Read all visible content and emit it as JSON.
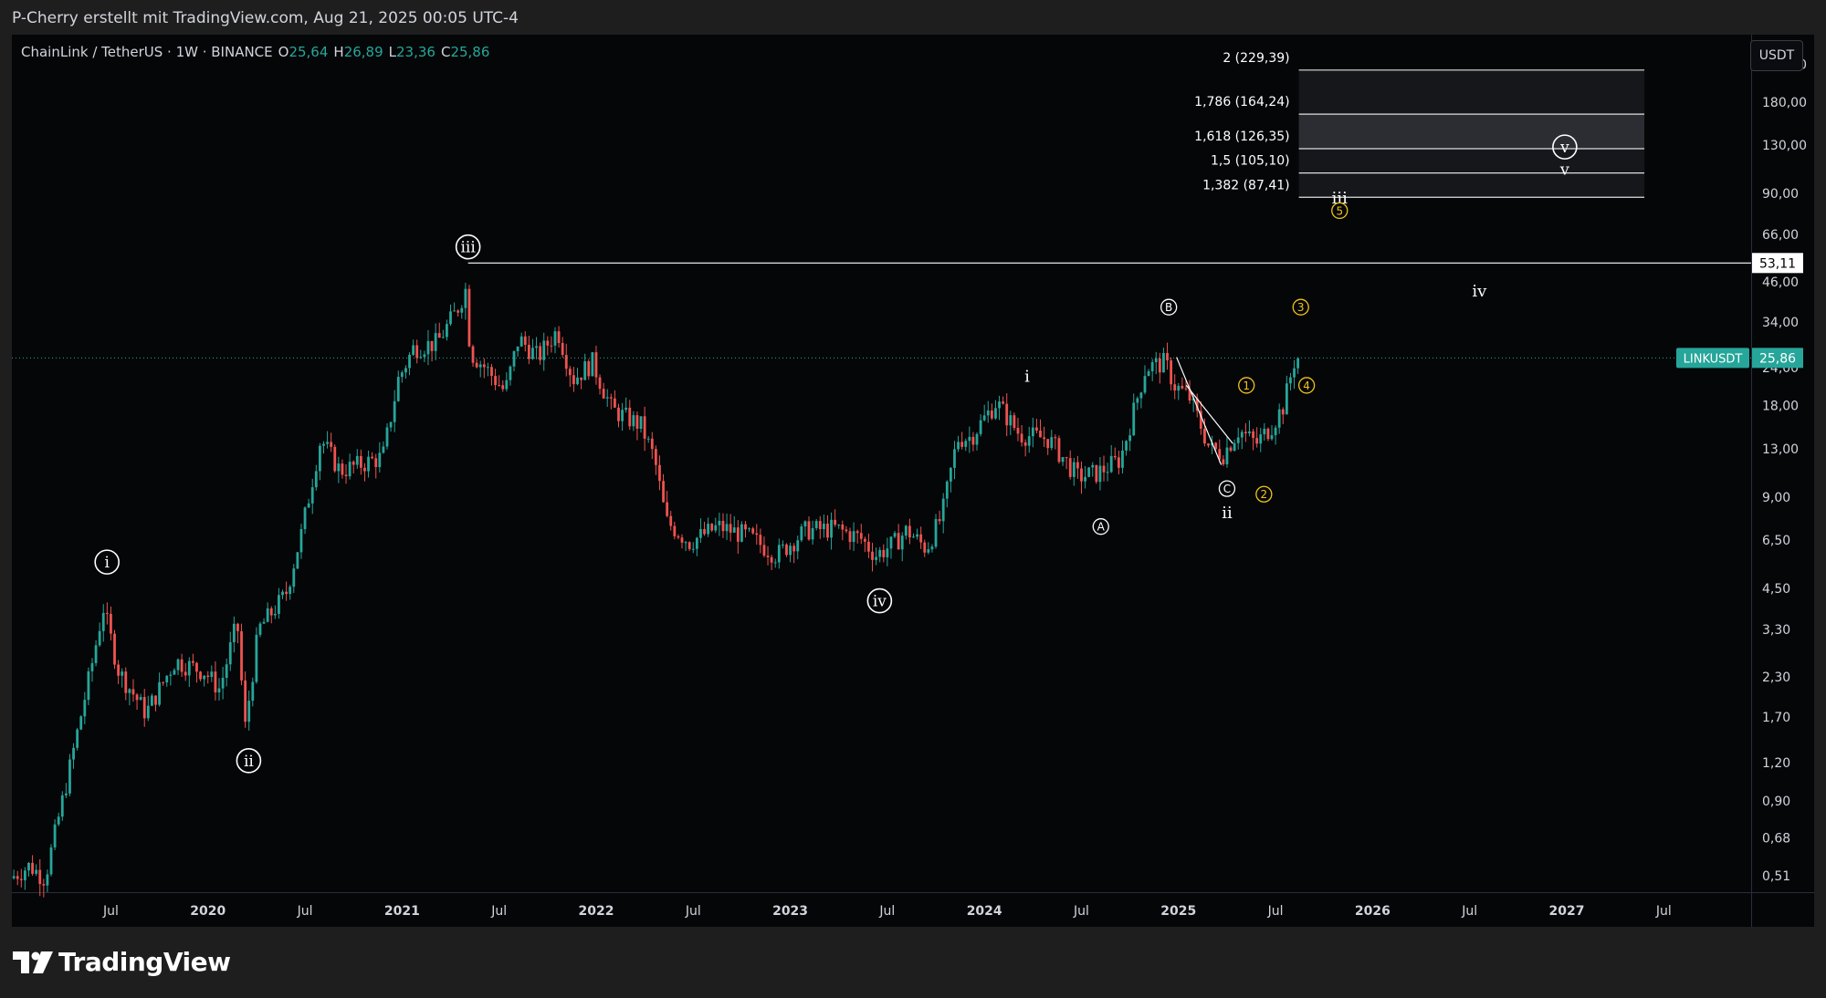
{
  "header": {
    "attribution": "P-Cherry erstellt mit TradingView.com, Aug 21, 2025 00:05 UTC-4"
  },
  "symbol": {
    "name": "ChainLink / TetherUS · 1W · BINANCE",
    "o_label": "O",
    "o_value": "25,64",
    "h_label": "H",
    "h_value": "26,89",
    "l_label": "L",
    "l_value": "23,36",
    "c_label": "C",
    "c_value": "25,86"
  },
  "currency_button": "USDT",
  "footer": {
    "logo_text": "TradingView"
  },
  "colors": {
    "up": "#26a69a",
    "down": "#ef5350",
    "background": "#050608",
    "label_yellow": "#f0c419",
    "price_tag": "#26a69a"
  },
  "chart_data": {
    "type": "candlestick",
    "scale": "log",
    "ylim": [
      0.45,
      300
    ],
    "y_ticks": [
      {
        "value": 240,
        "label": "240,00"
      },
      {
        "value": 180,
        "label": "180,00"
      },
      {
        "value": 130,
        "label": "130,00"
      },
      {
        "value": 90,
        "label": "90,00"
      },
      {
        "value": 66,
        "label": "66,00"
      },
      {
        "value": 46,
        "label": "46,00"
      },
      {
        "value": 34,
        "label": "34,00"
      },
      {
        "value": 24,
        "label": "24,00"
      },
      {
        "value": 18,
        "label": "18,00"
      },
      {
        "value": 13,
        "label": "13,00"
      },
      {
        "value": 9,
        "label": "9,00"
      },
      {
        "value": 6.5,
        "label": "6,50"
      },
      {
        "value": 4.5,
        "label": "4,50"
      },
      {
        "value": 3.3,
        "label": "3,30"
      },
      {
        "value": 2.3,
        "label": "2,30"
      },
      {
        "value": 1.7,
        "label": "1,70"
      },
      {
        "value": 1.2,
        "label": "1,20"
      },
      {
        "value": 0.9,
        "label": "0,90"
      },
      {
        "value": 0.68,
        "label": "0,68"
      },
      {
        "value": 0.51,
        "label": "0,51"
      }
    ],
    "x_ticks": [
      {
        "t": 2019.5,
        "label": "Jul",
        "bold": false
      },
      {
        "t": 2020.0,
        "label": "2020",
        "bold": true
      },
      {
        "t": 2020.5,
        "label": "Jul",
        "bold": false
      },
      {
        "t": 2021.0,
        "label": "2021",
        "bold": true
      },
      {
        "t": 2021.5,
        "label": "Jul",
        "bold": false
      },
      {
        "t": 2022.0,
        "label": "2022",
        "bold": true
      },
      {
        "t": 2022.5,
        "label": "Jul",
        "bold": false
      },
      {
        "t": 2023.0,
        "label": "2023",
        "bold": true
      },
      {
        "t": 2023.5,
        "label": "Jul",
        "bold": false
      },
      {
        "t": 2024.0,
        "label": "2024",
        "bold": true
      },
      {
        "t": 2024.5,
        "label": "Jul",
        "bold": false
      },
      {
        "t": 2025.0,
        "label": "2025",
        "bold": true
      },
      {
        "t": 2025.5,
        "label": "Jul",
        "bold": false
      },
      {
        "t": 2026.0,
        "label": "2026",
        "bold": true
      },
      {
        "t": 2026.5,
        "label": "Jul",
        "bold": false
      },
      {
        "t": 2027.0,
        "label": "2027",
        "bold": true
      },
      {
        "t": 2027.5,
        "label": "Jul",
        "bold": false
      }
    ],
    "price_path": [
      [
        2019.0,
        0.5
      ],
      [
        2019.1,
        0.55
      ],
      [
        2019.18,
        0.5
      ],
      [
        2019.3,
        1.1
      ],
      [
        2019.42,
        2.5
      ],
      [
        2019.48,
        3.9
      ],
      [
        2019.56,
        2.4
      ],
      [
        2019.7,
        1.75
      ],
      [
        2019.85,
        2.6
      ],
      [
        2020.0,
        2.4
      ],
      [
        2020.08,
        2.1
      ],
      [
        2020.17,
        3.5
      ],
      [
        2020.21,
        1.55
      ],
      [
        2020.28,
        3.3
      ],
      [
        2020.42,
        4.3
      ],
      [
        2020.5,
        6.8
      ],
      [
        2020.6,
        14.0
      ],
      [
        2020.7,
        11.0
      ],
      [
        2020.8,
        11.5
      ],
      [
        2020.92,
        12.2
      ],
      [
        2021.0,
        22.0
      ],
      [
        2021.08,
        28.0
      ],
      [
        2021.2,
        29.0
      ],
      [
        2021.3,
        37.0
      ],
      [
        2021.35,
        44.0
      ],
      [
        2021.37,
        27.0
      ],
      [
        2021.45,
        24.0
      ],
      [
        2021.55,
        20.0
      ],
      [
        2021.62,
        30.0
      ],
      [
        2021.72,
        26.0
      ],
      [
        2021.82,
        32.0
      ],
      [
        2021.9,
        22.0
      ],
      [
        2022.0,
        25.0
      ],
      [
        2022.1,
        17.5
      ],
      [
        2022.25,
        15.5
      ],
      [
        2022.32,
        12.0
      ],
      [
        2022.38,
        7.5
      ],
      [
        2022.5,
        6.4
      ],
      [
        2022.65,
        7.2
      ],
      [
        2022.8,
        6.7
      ],
      [
        2022.95,
        5.8
      ],
      [
        2023.1,
        7.0
      ],
      [
        2023.25,
        7.1
      ],
      [
        2023.38,
        6.6
      ],
      [
        2023.46,
        5.8
      ],
      [
        2023.55,
        6.3
      ],
      [
        2023.62,
        7.0
      ],
      [
        2023.72,
        6.1
      ],
      [
        2023.8,
        7.8
      ],
      [
        2023.88,
        14.0
      ],
      [
        2023.95,
        14.2
      ],
      [
        2024.08,
        18.5
      ],
      [
        2024.2,
        14.5
      ],
      [
        2024.35,
        14.0
      ],
      [
        2024.5,
        10.5
      ],
      [
        2024.6,
        10.8
      ],
      [
        2024.72,
        12.0
      ],
      [
        2024.85,
        24.0
      ],
      [
        2024.95,
        25.0
      ],
      [
        2025.0,
        21.0
      ],
      [
        2025.08,
        19.0
      ],
      [
        2025.18,
        13.0
      ],
      [
        2025.25,
        12.5
      ],
      [
        2025.33,
        15.0
      ],
      [
        2025.42,
        13.5
      ],
      [
        2025.5,
        15.5
      ],
      [
        2025.56,
        18.0
      ],
      [
        2025.62,
        25.86
      ]
    ],
    "last_price": {
      "value": 25.86,
      "label": "25,86",
      "symbol": "LINKUSDT"
    },
    "horizontal_level": {
      "value": 53.11,
      "label": "53,11",
      "t_start": 2021.34,
      "t_end": 2028.0
    },
    "fib_levels": [
      {
        "ratio_label": "2 (229,39)",
        "price": 229.39
      },
      {
        "ratio_label": "1,786 (164,24)",
        "price": 164.24
      },
      {
        "ratio_label": "1,618 (126,35)",
        "price": 126.35
      },
      {
        "ratio_label": "1,5 (105,10)",
        "price": 105.1
      },
      {
        "ratio_label": "1,382 (87,41)",
        "price": 87.41
      }
    ],
    "fib_range": {
      "t_start": 2025.62,
      "t_end": 2027.4
    },
    "wave_labels": [
      {
        "text": "i",
        "t": 2019.48,
        "price": 5.5,
        "style": "circle-white"
      },
      {
        "text": "ii",
        "t": 2020.21,
        "price": 1.22,
        "style": "circle-white"
      },
      {
        "text": "iii",
        "t": 2021.34,
        "price": 60.0,
        "style": "circle-white"
      },
      {
        "text": "iv",
        "t": 2023.46,
        "price": 4.1,
        "style": "circle-white"
      },
      {
        "text": "v",
        "t": 2026.99,
        "price": 128.0,
        "style": "circle-white"
      },
      {
        "text": "v",
        "t": 2026.99,
        "price": 108.0,
        "style": "plain-white"
      },
      {
        "text": "i",
        "t": 2024.22,
        "price": 22.5,
        "style": "plain-white"
      },
      {
        "text": "A",
        "t": 2024.6,
        "price": 7.2,
        "style": "circle-small"
      },
      {
        "text": "B",
        "t": 2024.95,
        "price": 38.0,
        "style": "circle-small"
      },
      {
        "text": "C",
        "t": 2025.25,
        "price": 9.6,
        "style": "circle-small"
      },
      {
        "text": "ii",
        "t": 2025.25,
        "price": 8.0,
        "style": "plain-white"
      },
      {
        "text": "iii",
        "t": 2025.83,
        "price": 87.0,
        "style": "plain-white"
      },
      {
        "text": "iv",
        "t": 2026.55,
        "price": 43.0,
        "style": "plain-white"
      },
      {
        "text": "1",
        "t": 2025.35,
        "price": 21.0,
        "style": "circle-yellow"
      },
      {
        "text": "2",
        "t": 2025.44,
        "price": 9.2,
        "style": "circle-yellow"
      },
      {
        "text": "3",
        "t": 2025.63,
        "price": 38.0,
        "style": "circle-yellow"
      },
      {
        "text": "4",
        "t": 2025.66,
        "price": 21.0,
        "style": "circle-yellow"
      },
      {
        "text": "5",
        "t": 2025.83,
        "price": 79.0,
        "style": "circle-yellow"
      }
    ]
  }
}
